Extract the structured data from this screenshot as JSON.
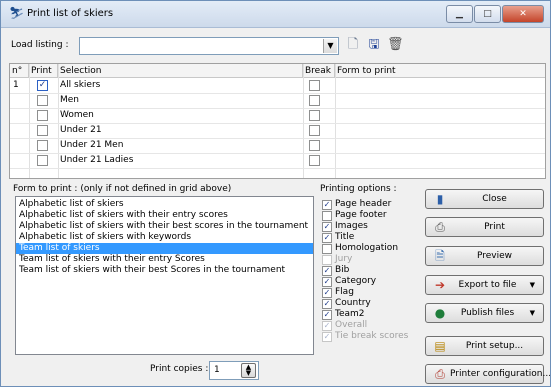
{
  "window": {
    "title": "Print list of skiers",
    "buttons": {
      "minimize": "▁",
      "maximize": "□",
      "close": "✕"
    }
  },
  "load": {
    "label": "Load listing :",
    "value": ""
  },
  "grid": {
    "headers": {
      "n": "n°",
      "print": "Print",
      "selection": "Selection",
      "break": "Break",
      "form": "Form to print"
    },
    "rows": [
      {
        "n": "1",
        "print": "✓",
        "selection": "All skiers",
        "break": "",
        "form": ""
      },
      {
        "n": "",
        "print": "",
        "selection": "Men",
        "break": "",
        "form": ""
      },
      {
        "n": "",
        "print": "",
        "selection": "Women",
        "break": "",
        "form": ""
      },
      {
        "n": "",
        "print": "",
        "selection": "Under 21",
        "break": "",
        "form": ""
      },
      {
        "n": "",
        "print": "",
        "selection": "Under 21 Men",
        "break": "",
        "form": ""
      },
      {
        "n": "",
        "print": "",
        "selection": "Under 21 Ladies",
        "break": "",
        "form": ""
      }
    ]
  },
  "form": {
    "label": "Form to print :  (only if not defined in grid above)",
    "items": [
      "Alphabetic list of skiers",
      "Alphabetic list of skiers with their entry scores",
      "Alphabetic list of skiers with their best scores in the tournament",
      "Alphabetic list of skiers with keywords",
      "Team list of skiers",
      "Team list of skiers with their entry Scores",
      "Team list of skiers with their best Scores in the tournament"
    ],
    "selected": "Team list of skiers"
  },
  "copies": {
    "label": "Print copies :",
    "value": "1"
  },
  "options": {
    "label": "Printing options :",
    "items": [
      {
        "label": "Page header",
        "checked": "✓"
      },
      {
        "label": "Page footer",
        "checked": ""
      },
      {
        "label": "Images",
        "checked": "✓"
      },
      {
        "label": "Title",
        "checked": "✓"
      },
      {
        "label": "Homologation",
        "checked": ""
      },
      {
        "label": "Jury",
        "checked": ""
      },
      {
        "label": "Bib",
        "checked": "✓"
      },
      {
        "label": "Category",
        "checked": "✓"
      },
      {
        "label": "Flag",
        "checked": "✓"
      },
      {
        "label": "Country",
        "checked": "✓"
      },
      {
        "label": "Team2",
        "checked": "✓"
      },
      {
        "label": "Overall",
        "checked": "✓"
      },
      {
        "label": "Tie break scores",
        "checked": "✓"
      }
    ]
  },
  "actions": {
    "close": "Close",
    "print": "Print",
    "preview": "Preview",
    "export": "Export to file",
    "publish": "Publish files",
    "setup": "Print setup...",
    "config": "Printer configuration..."
  },
  "dropdown_glyph": "▼",
  "colors": {
    "selection": "#3399ff",
    "title_bar": "#cddaeb",
    "close_button": "#c4442a"
  }
}
